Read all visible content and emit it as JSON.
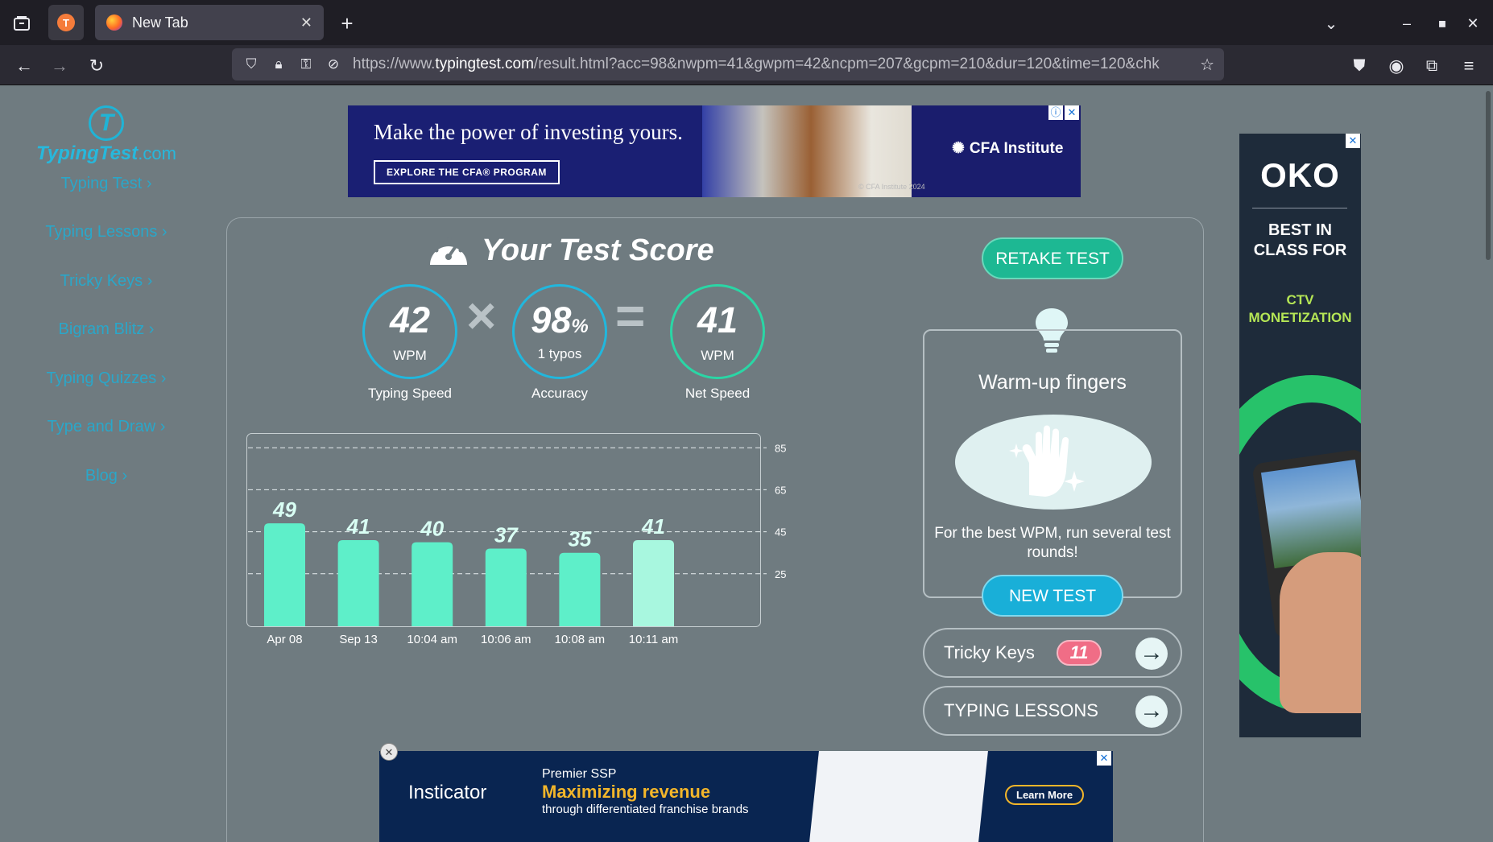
{
  "browser": {
    "tab_title": "New Tab",
    "url_prefix": "https://www.",
    "url_domain": "typingtest.com",
    "url_rest": "/result.html?acc=98&nwpm=41&gwpm=42&ncpm=207&gcpm=210&dur=120&time=120&chk"
  },
  "sidebar": {
    "logo_text": "TypingTest",
    "logo_suffix": ".com",
    "links": [
      "Typing Test ›",
      "Typing Lessons ›",
      "Tricky Keys ›",
      "Bigram Blitz ›",
      "Typing Quizzes ›",
      "Type and Draw ›",
      "Blog ›"
    ]
  },
  "ads": {
    "top": {
      "headline": "Make the power of investing yours.",
      "cta": "EXPLORE THE CFA® PROGRAM",
      "brand": "CFA Institute",
      "copyright": "© CFA Institute 2024"
    },
    "right": {
      "brand": "OKO",
      "slogan": "BEST IN CLASS FOR",
      "slogan2": "CTV MONETIZATION"
    },
    "bottom": {
      "brand": "Insticator",
      "line1": "Premier SSP",
      "line2": "Maximizing revenue",
      "line3": "through differentiated franchise brands",
      "cta": "Learn More"
    }
  },
  "score": {
    "title": "Your Test Score",
    "typing_speed": {
      "value": "42",
      "unit": "WPM",
      "label": "Typing Speed"
    },
    "accuracy": {
      "value": "98",
      "pct": "%",
      "sub": "1 typos",
      "label": "Accuracy"
    },
    "net_speed": {
      "value": "41",
      "unit": "WPM",
      "label": "Net Speed"
    },
    "times_op": "×",
    "equals_op": "="
  },
  "chart_data": {
    "type": "bar",
    "categories": [
      "Apr 08",
      "Sep 13",
      "10:04 am",
      "10:06 am",
      "10:08 am",
      "10:11 am"
    ],
    "values": [
      49,
      41,
      40,
      37,
      35,
      41
    ],
    "yticks": [
      85,
      65,
      45,
      25
    ],
    "ylim": [
      0,
      92
    ],
    "grid": "dashed horizontal",
    "colors": {
      "bar": "#5eefc9",
      "last_bar": "#a8f7df",
      "label": "#d9fff4"
    }
  },
  "right_panel": {
    "retake_label": "RETAKE TEST",
    "tip_title": "Warm-up fingers",
    "tip_text": "For the best WPM, run several test rounds!",
    "new_test_label": "NEW TEST",
    "tricky_keys_label": "Tricky Keys",
    "tricky_keys_count": "11",
    "typing_lessons_label": "TYPING LESSONS"
  }
}
